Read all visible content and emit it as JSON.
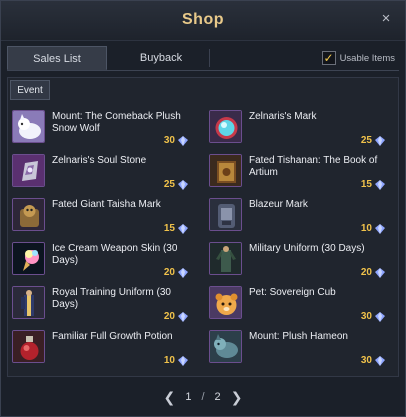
{
  "window": {
    "title": "Shop",
    "close_glyph": "×"
  },
  "tabs": [
    {
      "label": "Sales List",
      "active": true
    },
    {
      "label": "Buyback",
      "active": false
    }
  ],
  "usable_items": {
    "label": "Usable Items",
    "checked": true,
    "check_glyph": "✓"
  },
  "subtab": {
    "label": "Event"
  },
  "currency_icon": "crystal-gem-icon",
  "items": [
    {
      "name": "Mount: The Comeback Plush Snow Wolf",
      "price": "30",
      "icon": "snow-wolf-icon"
    },
    {
      "name": "Zelnaris's Mark",
      "price": "25",
      "icon": "mark-orb-icon"
    },
    {
      "name": "Zelnaris's Soul Stone",
      "price": "25",
      "icon": "soul-stone-icon"
    },
    {
      "name": "Fated Tishanan: The Book of Artium",
      "price": "15",
      "icon": "book-icon"
    },
    {
      "name": "Fated Giant Taisha Mark",
      "price": "15",
      "icon": "giant-mark-icon"
    },
    {
      "name": "Blazeur Mark",
      "price": "10",
      "icon": "blazeur-mark-icon"
    },
    {
      "name": "Ice Cream Weapon Skin (30 Days)",
      "price": "20",
      "icon": "ice-cream-icon"
    },
    {
      "name": "Military Uniform (30 Days)",
      "price": "20",
      "icon": "military-uniform-icon"
    },
    {
      "name": "Royal Training Uniform (30 Days)",
      "price": "20",
      "icon": "royal-uniform-icon"
    },
    {
      "name": "Pet: Sovereign Cub",
      "price": "30",
      "icon": "cub-pet-icon"
    },
    {
      "name": "Familiar Full Growth Potion",
      "price": "10",
      "icon": "potion-icon"
    },
    {
      "name": "Mount: Plush Hameon",
      "price": "30",
      "icon": "hameon-mount-icon"
    }
  ],
  "pager": {
    "current": "1",
    "separator": "/",
    "total": "2",
    "prev_glyph": "❮",
    "next_glyph": "❯"
  }
}
